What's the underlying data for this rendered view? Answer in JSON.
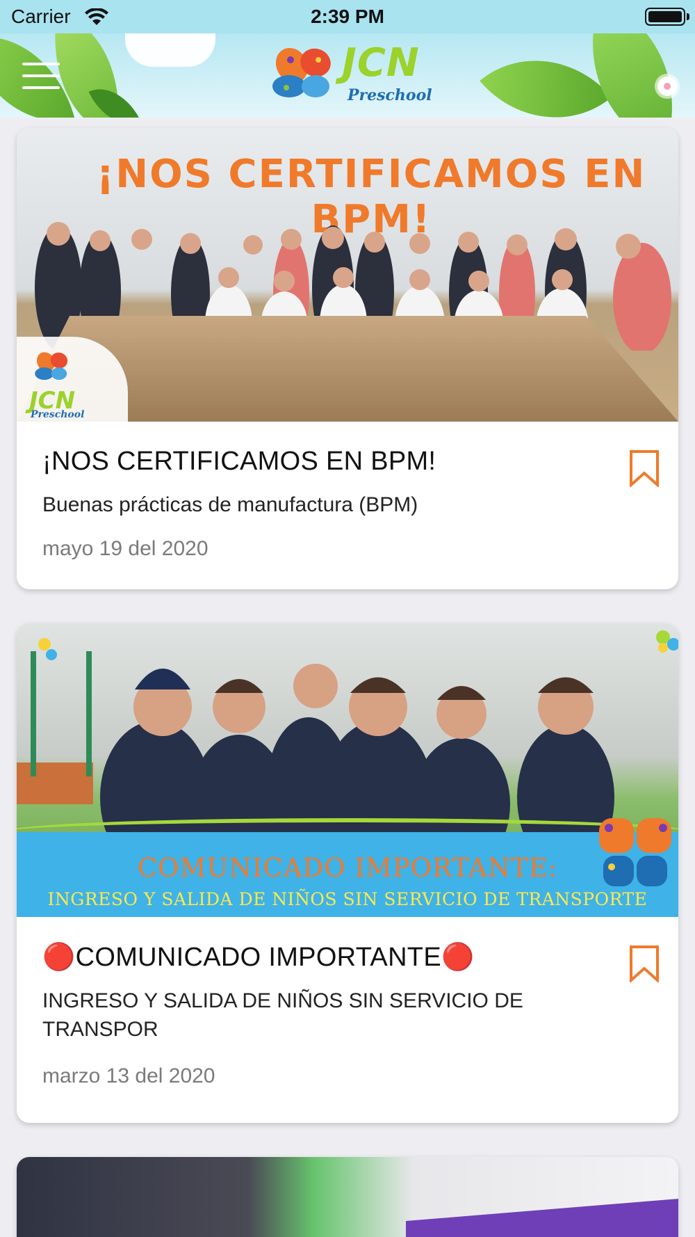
{
  "status_bar": {
    "carrier": "Carrier",
    "time": "2:39 PM"
  },
  "header": {
    "logo_word": "JCN",
    "logo_sub": "Preschool"
  },
  "posts": [
    {
      "image_banner": "¡NOS CERTIFICAMOS EN BPM!",
      "image_logo_word": "JCN",
      "image_logo_sub": "Preschool",
      "title": "¡NOS CERTIFICAMOS EN BPM!",
      "subtitle": "Buenas prácticas de manufactura (BPM)",
      "date": "mayo 19 del 2020"
    },
    {
      "image_line1": "COMUNICADO IMPORTANTE:",
      "image_line2": "INGRESO Y SALIDA DE NIÑOS SIN SERVICIO DE TRANSPORTE",
      "title": "🔴COMUNICADO IMPORTANTE🔴",
      "subtitle": "INGRESO Y SALIDA DE NIÑOS SIN SERVICIO DE TRANSPOR",
      "date": "marzo 13 del 2020"
    }
  ],
  "colors": {
    "accent": "#f07a2b",
    "status_bar_bg": "#a8e3ef",
    "page_bg": "#eeeef2"
  },
  "icons": {
    "menu": "hamburger-icon",
    "bookmark": "bookmark-icon",
    "wifi": "wifi-icon",
    "battery": "battery-icon"
  }
}
